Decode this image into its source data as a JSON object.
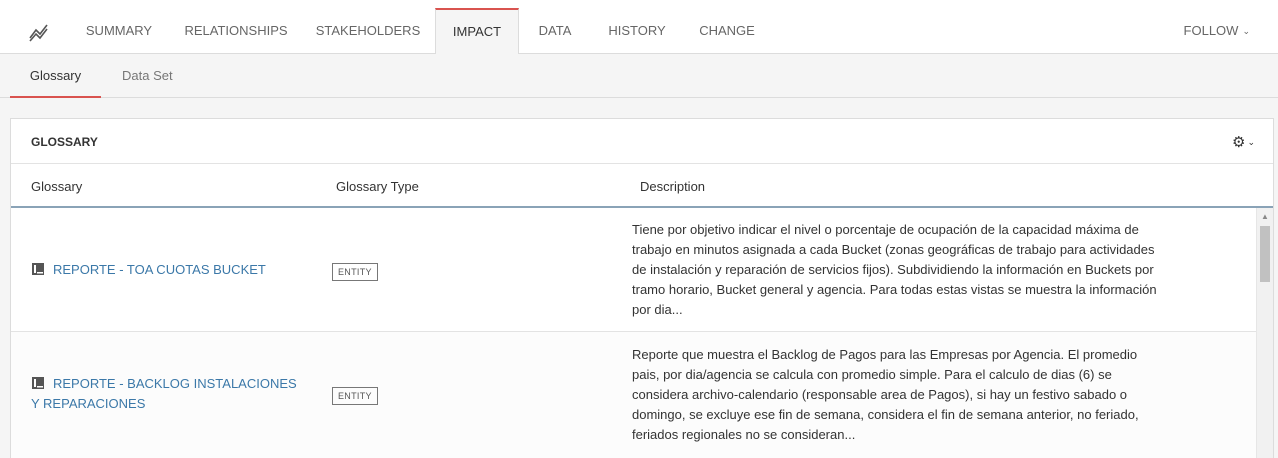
{
  "nav": {
    "tabs": [
      "SUMMARY",
      "RELATIONSHIPS",
      "STAKEHOLDERS",
      "IMPACT",
      "DATA",
      "HISTORY",
      "CHANGE"
    ],
    "active_tab": "IMPACT",
    "follow_label": "FOLLOW"
  },
  "subnav": {
    "tabs": [
      "Glossary",
      "Data Set"
    ],
    "active": "Glossary"
  },
  "panel": {
    "title": "GLOSSARY",
    "columns": [
      "Glossary",
      "Glossary Type",
      "Description"
    ],
    "rows": [
      {
        "name": "REPORTE - TOA CUOTAS BUCKET",
        "type": "ENTITY",
        "description_lines": [
          "Tiene por objetivo indicar el nivel o porcentaje de ocupación de la capacidad máxima de",
          "trabajo en minutos asignada a cada Bucket (zonas geográficas de trabajo para actividades",
          "de instalación y reparación de servicios fijos). Subdividiendo la información en Buckets por",
          "tramo horario, Bucket general y agencia. Para todas estas vistas se muestra la información",
          "por dia..."
        ]
      },
      {
        "name_lines": [
          "REPORTE - BACKLOG INSTALACIONES",
          "Y REPARACIONES"
        ],
        "type": "ENTITY",
        "description_lines": [
          "Reporte que muestra el Backlog de Pagos para las Empresas por Agencia. El promedio",
          "pais, por dia/agencia se calcula con promedio simple. Para el calculo de dias (6) se",
          "considera archivo-calendario (responsable area de Pagos), si hay un festivo sabado o",
          "domingo, se excluye ese fin de semana, considera el fin de semana anterior, no feriado,",
          "feriados regionales no se consideran..."
        ]
      }
    ]
  },
  "colors": {
    "accent": "#d9534f",
    "link": "#3b78a8",
    "header_rule": "#8aa3b7"
  },
  "icons": [
    "trend-icon",
    "chevron-down-icon",
    "gear-icon",
    "book-icon",
    "scroll-up-icon"
  ]
}
